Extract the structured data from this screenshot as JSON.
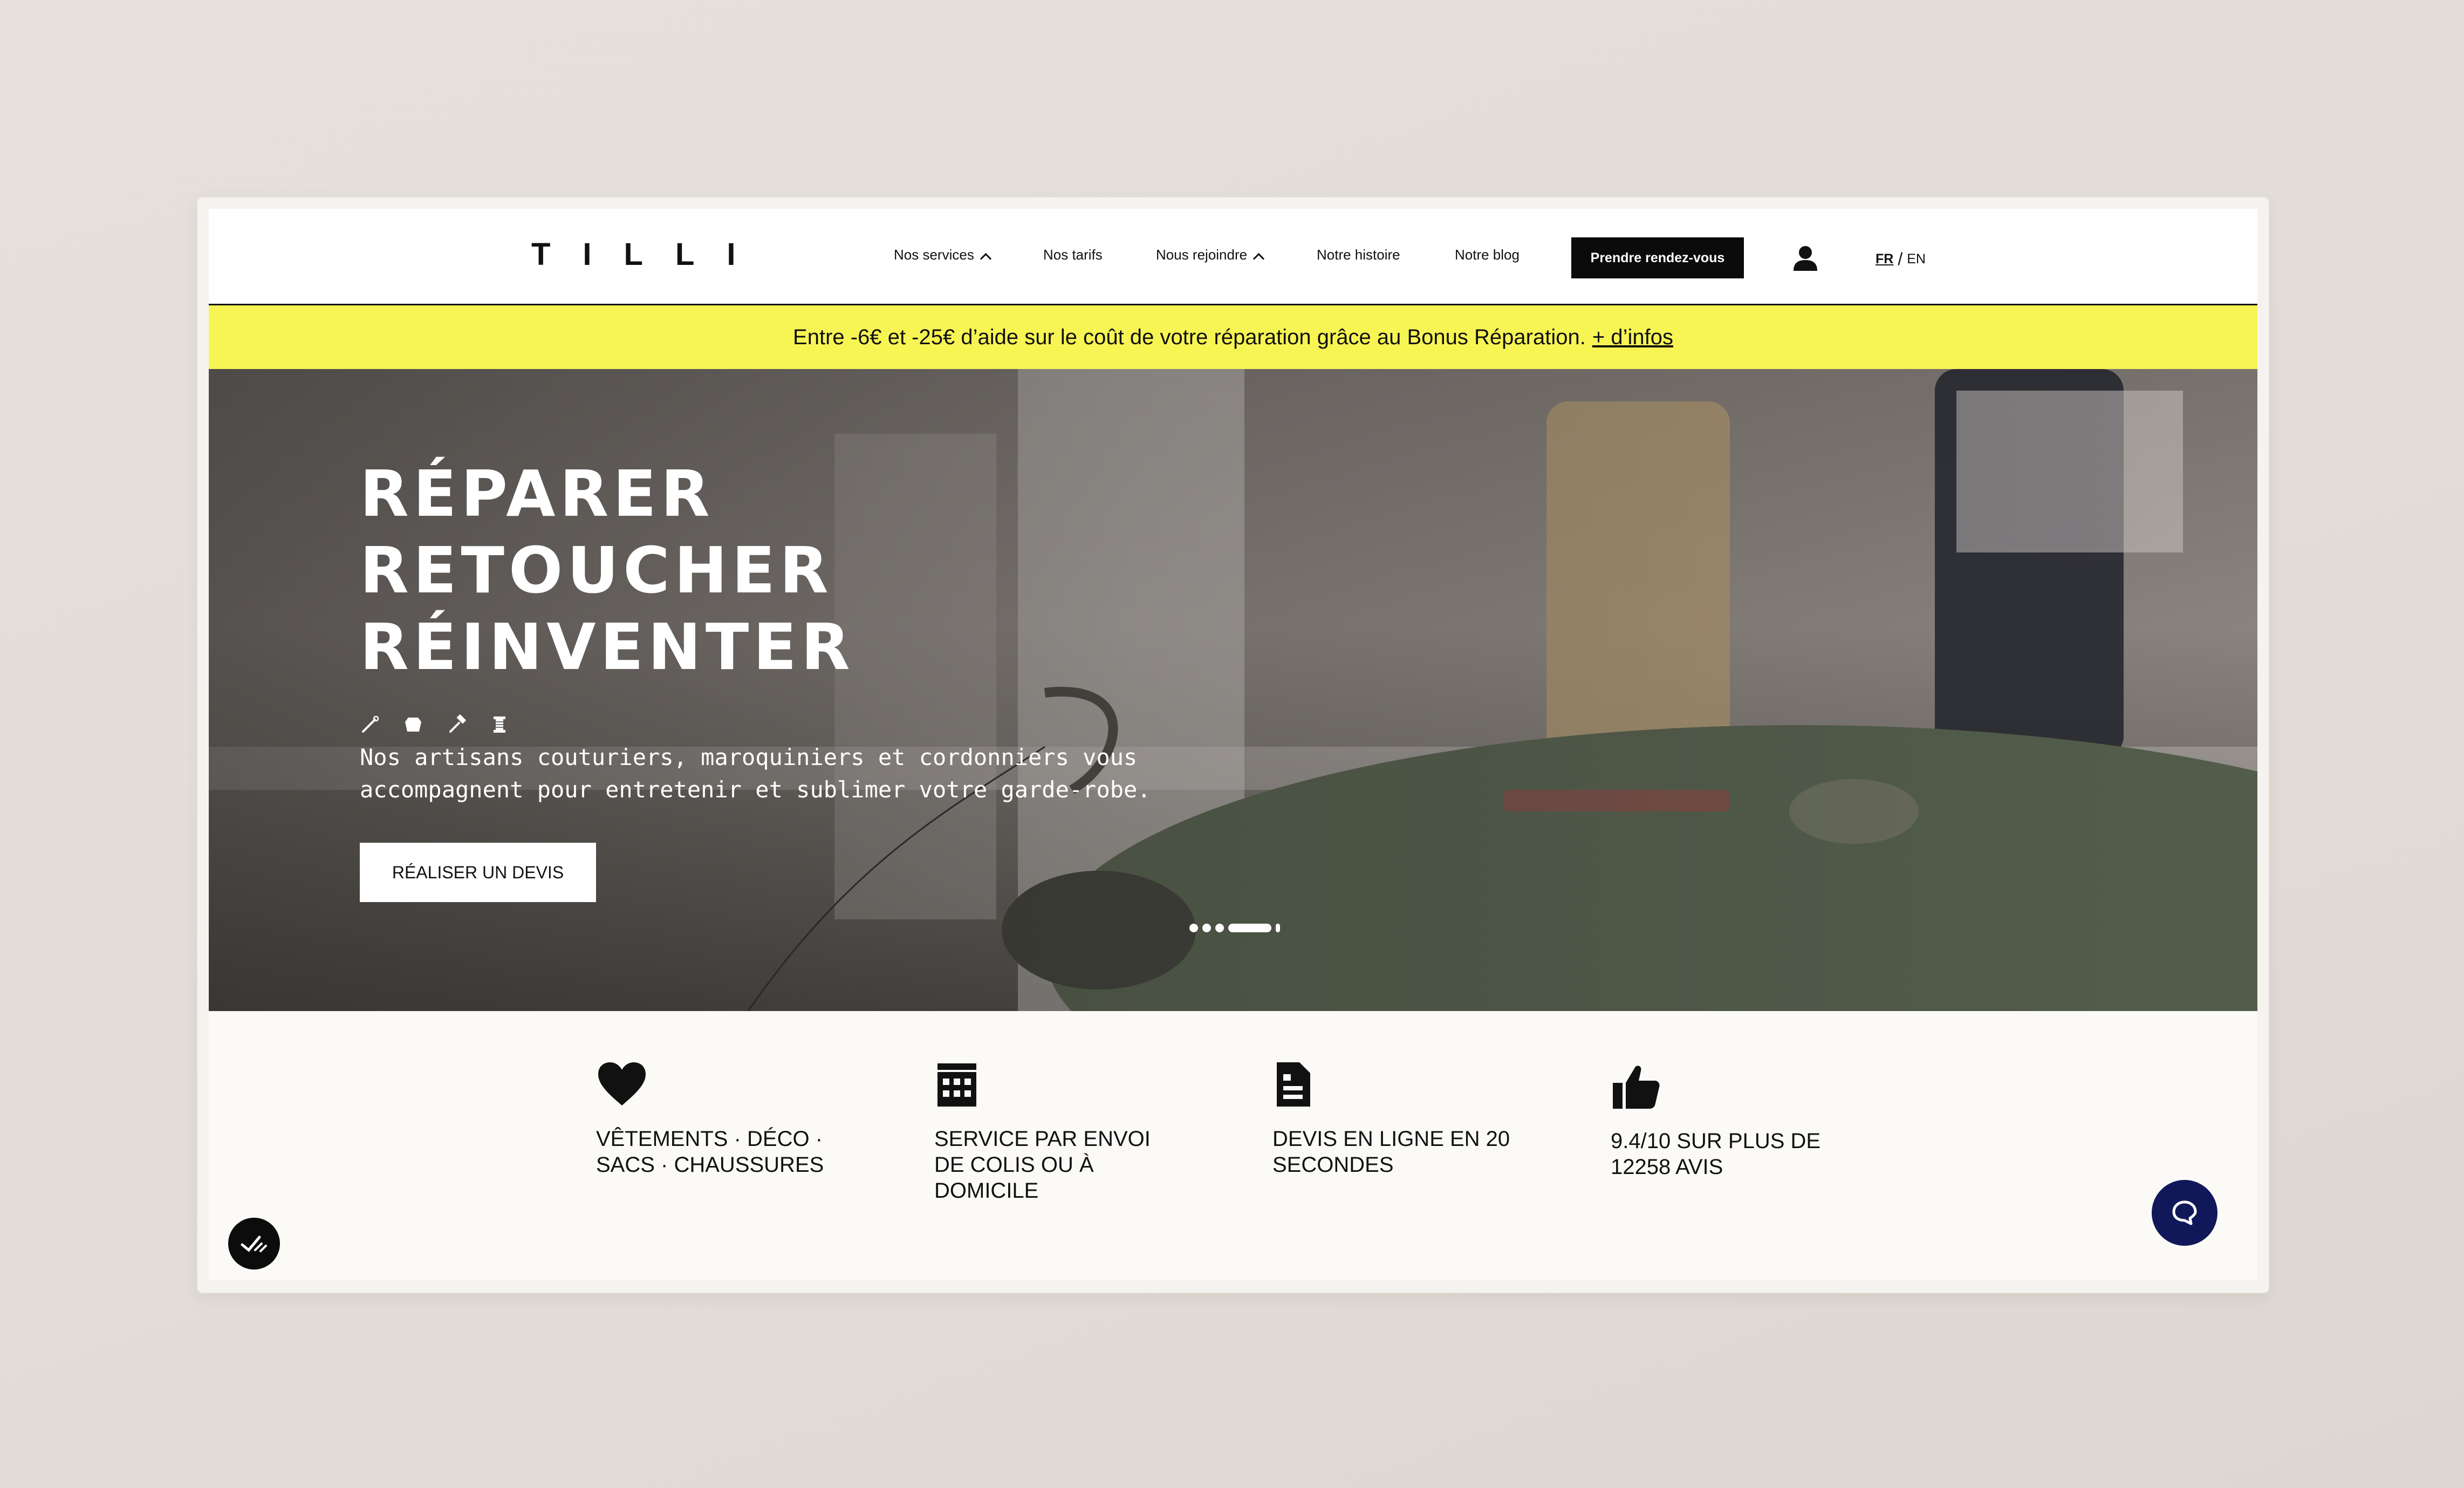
{
  "header": {
    "logo": "TILLI",
    "nav": [
      {
        "label": "Nos services",
        "dropdown": true
      },
      {
        "label": "Nos tarifs",
        "dropdown": false
      },
      {
        "label": "Nous rejoindre",
        "dropdown": true
      },
      {
        "label": "Notre histoire",
        "dropdown": false
      },
      {
        "label": "Notre blog",
        "dropdown": false
      }
    ],
    "cta_label": "Prendre rendez-vous",
    "user_icon": "user-icon",
    "lang": {
      "fr": "FR",
      "separator": "/",
      "en": "EN"
    }
  },
  "banner": {
    "text": "Entre -6€ et -25€ d’aide sur le coût de votre réparation grâce au Bonus Réparation.",
    "link": "+ d’infos",
    "color": "#f7f553"
  },
  "hero": {
    "title_lines": [
      "RÉPARER",
      "RETOUCHER",
      "RÉINVENTER"
    ],
    "icons": [
      "needle-icon",
      "leather-icon",
      "hammer-icon",
      "thread-spool-icon"
    ],
    "subtitle": "Nos artisans couturiers, maroquiniers et cordonniers vous accompagnent pour entretenir et sublimer votre garde-robe.",
    "button_label": "RÉALISER UN DEVIS"
  },
  "features": [
    {
      "icon": "heart-icon",
      "label": "VÊTEMENTS · DÉCO · SACS · CHAUSSURES"
    },
    {
      "icon": "calendar-icon",
      "label": "SERVICE PAR ENVOI DE COLIS OU À DOMICILE"
    },
    {
      "icon": "quote-document-icon",
      "label": "DEVIS EN LIGNE EN 20 SECONDES"
    },
    {
      "icon": "thumbs-up-icon",
      "label": "9.4/10 SUR PLUS DE 12258 AVIS"
    }
  ],
  "chat_icon": "chat-bubble-icon",
  "colors": {
    "accent": "#f7f553",
    "dark": "#0b0b0b",
    "chat": "#11185a"
  }
}
